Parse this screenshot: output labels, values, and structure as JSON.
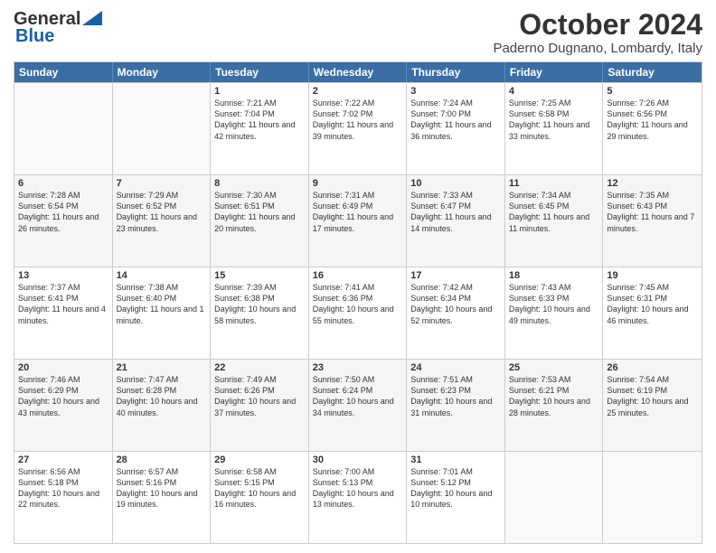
{
  "logo": {
    "line1": "General",
    "line2": "Blue"
  },
  "header": {
    "month": "October 2024",
    "location": "Paderno Dugnano, Lombardy, Italy"
  },
  "days": [
    "Sunday",
    "Monday",
    "Tuesday",
    "Wednesday",
    "Thursday",
    "Friday",
    "Saturday"
  ],
  "rows": [
    [
      {
        "num": "",
        "text": ""
      },
      {
        "num": "",
        "text": ""
      },
      {
        "num": "1",
        "text": "Sunrise: 7:21 AM\nSunset: 7:04 PM\nDaylight: 11 hours and 42 minutes."
      },
      {
        "num": "2",
        "text": "Sunrise: 7:22 AM\nSunset: 7:02 PM\nDaylight: 11 hours and 39 minutes."
      },
      {
        "num": "3",
        "text": "Sunrise: 7:24 AM\nSunset: 7:00 PM\nDaylight: 11 hours and 36 minutes."
      },
      {
        "num": "4",
        "text": "Sunrise: 7:25 AM\nSunset: 6:58 PM\nDaylight: 11 hours and 33 minutes."
      },
      {
        "num": "5",
        "text": "Sunrise: 7:26 AM\nSunset: 6:56 PM\nDaylight: 11 hours and 29 minutes."
      }
    ],
    [
      {
        "num": "6",
        "text": "Sunrise: 7:28 AM\nSunset: 6:54 PM\nDaylight: 11 hours and 26 minutes."
      },
      {
        "num": "7",
        "text": "Sunrise: 7:29 AM\nSunset: 6:52 PM\nDaylight: 11 hours and 23 minutes."
      },
      {
        "num": "8",
        "text": "Sunrise: 7:30 AM\nSunset: 6:51 PM\nDaylight: 11 hours and 20 minutes."
      },
      {
        "num": "9",
        "text": "Sunrise: 7:31 AM\nSunset: 6:49 PM\nDaylight: 11 hours and 17 minutes."
      },
      {
        "num": "10",
        "text": "Sunrise: 7:33 AM\nSunset: 6:47 PM\nDaylight: 11 hours and 14 minutes."
      },
      {
        "num": "11",
        "text": "Sunrise: 7:34 AM\nSunset: 6:45 PM\nDaylight: 11 hours and 11 minutes."
      },
      {
        "num": "12",
        "text": "Sunrise: 7:35 AM\nSunset: 6:43 PM\nDaylight: 11 hours and 7 minutes."
      }
    ],
    [
      {
        "num": "13",
        "text": "Sunrise: 7:37 AM\nSunset: 6:41 PM\nDaylight: 11 hours and 4 minutes."
      },
      {
        "num": "14",
        "text": "Sunrise: 7:38 AM\nSunset: 6:40 PM\nDaylight: 11 hours and 1 minute."
      },
      {
        "num": "15",
        "text": "Sunrise: 7:39 AM\nSunset: 6:38 PM\nDaylight: 10 hours and 58 minutes."
      },
      {
        "num": "16",
        "text": "Sunrise: 7:41 AM\nSunset: 6:36 PM\nDaylight: 10 hours and 55 minutes."
      },
      {
        "num": "17",
        "text": "Sunrise: 7:42 AM\nSunset: 6:34 PM\nDaylight: 10 hours and 52 minutes."
      },
      {
        "num": "18",
        "text": "Sunrise: 7:43 AM\nSunset: 6:33 PM\nDaylight: 10 hours and 49 minutes."
      },
      {
        "num": "19",
        "text": "Sunrise: 7:45 AM\nSunset: 6:31 PM\nDaylight: 10 hours and 46 minutes."
      }
    ],
    [
      {
        "num": "20",
        "text": "Sunrise: 7:46 AM\nSunset: 6:29 PM\nDaylight: 10 hours and 43 minutes."
      },
      {
        "num": "21",
        "text": "Sunrise: 7:47 AM\nSunset: 6:28 PM\nDaylight: 10 hours and 40 minutes."
      },
      {
        "num": "22",
        "text": "Sunrise: 7:49 AM\nSunset: 6:26 PM\nDaylight: 10 hours and 37 minutes."
      },
      {
        "num": "23",
        "text": "Sunrise: 7:50 AM\nSunset: 6:24 PM\nDaylight: 10 hours and 34 minutes."
      },
      {
        "num": "24",
        "text": "Sunrise: 7:51 AM\nSunset: 6:23 PM\nDaylight: 10 hours and 31 minutes."
      },
      {
        "num": "25",
        "text": "Sunrise: 7:53 AM\nSunset: 6:21 PM\nDaylight: 10 hours and 28 minutes."
      },
      {
        "num": "26",
        "text": "Sunrise: 7:54 AM\nSunset: 6:19 PM\nDaylight: 10 hours and 25 minutes."
      }
    ],
    [
      {
        "num": "27",
        "text": "Sunrise: 6:56 AM\nSunset: 5:18 PM\nDaylight: 10 hours and 22 minutes."
      },
      {
        "num": "28",
        "text": "Sunrise: 6:57 AM\nSunset: 5:16 PM\nDaylight: 10 hours and 19 minutes."
      },
      {
        "num": "29",
        "text": "Sunrise: 6:58 AM\nSunset: 5:15 PM\nDaylight: 10 hours and 16 minutes."
      },
      {
        "num": "30",
        "text": "Sunrise: 7:00 AM\nSunset: 5:13 PM\nDaylight: 10 hours and 13 minutes."
      },
      {
        "num": "31",
        "text": "Sunrise: 7:01 AM\nSunset: 5:12 PM\nDaylight: 10 hours and 10 minutes."
      },
      {
        "num": "",
        "text": ""
      },
      {
        "num": "",
        "text": ""
      }
    ]
  ]
}
